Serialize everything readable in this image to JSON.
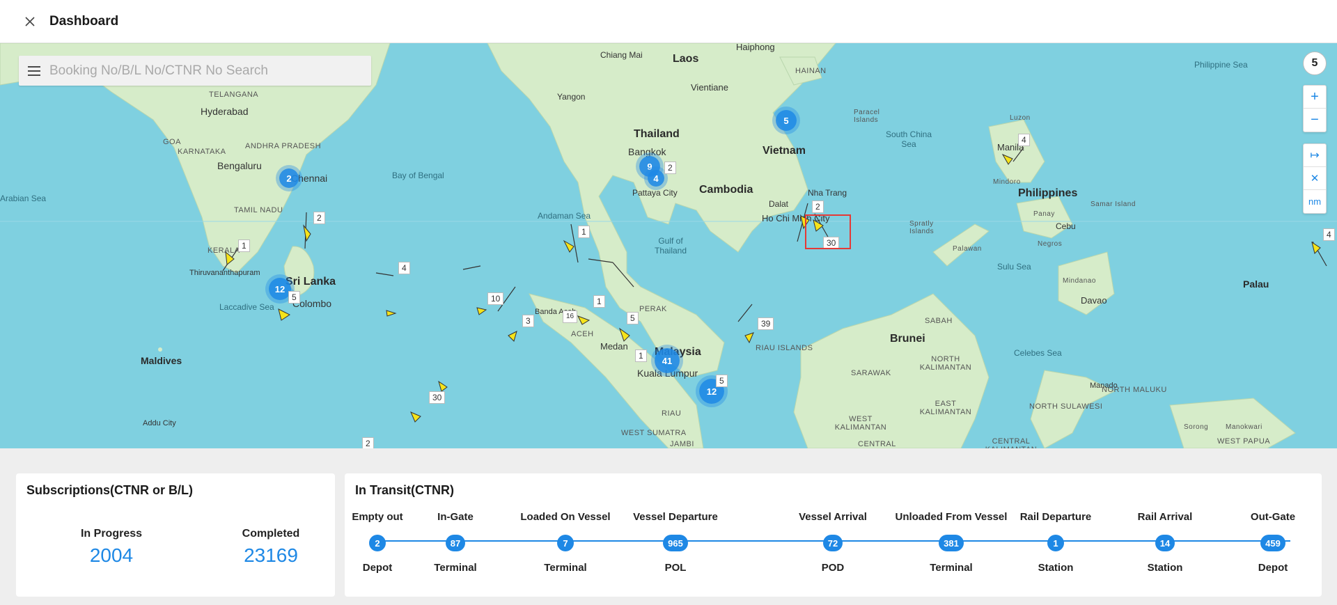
{
  "header": {
    "title": "Dashboard"
  },
  "search": {
    "placeholder": "Booking No/B/L No/CTNR No Search"
  },
  "map": {
    "zoom_level": "5",
    "controls": {
      "zoom_in": "+",
      "zoom_out": "−",
      "fit": "↦",
      "clear": "✕",
      "unit": "nm"
    },
    "countries": [
      "Laos",
      "Thailand",
      "Vietnam",
      "Cambodia",
      "Philippines",
      "Malaysia",
      "Brunei",
      "Sri Lanka",
      "Maldives",
      "Palau"
    ],
    "cities": [
      "Hyderabad",
      "Bengaluru",
      "Chennai",
      "Bangkok",
      "Pattaya City",
      "Ho Chi Minh City",
      "Nha Trang",
      "Dalat",
      "Kuala Lumpur",
      "Colombo",
      "Manila",
      "Cebu",
      "Davao",
      "Vientiane",
      "Yangon",
      "Haiphong",
      "Chiang Mai",
      "Medan",
      "Manado",
      "Addu City",
      "Thiruvananthapuram",
      "Banda Aceh"
    ],
    "seas": [
      "Bay of Bengal",
      "Andaman Sea",
      "Gulf of Thailand",
      "South China Sea",
      "Sulu Sea",
      "Celebes Sea",
      "Philippine Sea",
      "Laccadive Sea",
      "Arabian Sea"
    ],
    "regions": [
      "TELANGANA",
      "ANDHRA PRADESH",
      "KARNATAKA",
      "TAMIL NADU",
      "GOA",
      "KERALA",
      "PERAK",
      "ACEH",
      "RIAU",
      "SABAH",
      "SARAWAK",
      "NORTH KALIMANTAN",
      "EAST KALIMANTAN",
      "WEST KALIMANTAN",
      "CENTRAL KALIMANTAN",
      "NORTH SULAWESI",
      "NORTH MALUKU",
      "WEST SUMATRA",
      "JAMBI",
      "WEST PAPUA",
      "CENTRAL",
      "RIAU ISLANDS",
      "HAINAN",
      "Paracel Islands",
      "Spratly Islands",
      "Palawan",
      "Mindoro",
      "Panay",
      "Negros",
      "Mindanao",
      "Luzon",
      "Samar Island",
      "Sorong",
      "Manokwari"
    ],
    "clusters": [
      {
        "count": "5"
      },
      {
        "count": "9"
      },
      {
        "count": "4"
      },
      {
        "count": "2"
      },
      {
        "count": "12"
      },
      {
        "count": "41"
      },
      {
        "count": "12"
      }
    ],
    "vessel_tags": [
      "2",
      "4",
      "2",
      "30",
      "4",
      "1",
      "1",
      "2",
      "1",
      "4",
      "10",
      "3",
      "5",
      "1",
      "39",
      "30",
      "16",
      "5",
      "2",
      "5"
    ]
  },
  "subscriptions": {
    "title": "Subscriptions(CTNR or B/L)",
    "in_progress": {
      "label": "In Progress",
      "value": "2004"
    },
    "completed": {
      "label": "Completed",
      "value": "23169"
    }
  },
  "transit": {
    "title": "In Transit(CTNR)",
    "stages": [
      {
        "top": "Empty out",
        "count": "2",
        "bottom": "Depot"
      },
      {
        "top": "In-Gate",
        "count": "87",
        "bottom": "Terminal"
      },
      {
        "top": "Loaded On Vessel",
        "count": "7",
        "bottom": "Terminal"
      },
      {
        "top": "Vessel Departure",
        "count": "965",
        "bottom": "POL"
      },
      {
        "top": "Vessel Arrival",
        "count": "72",
        "bottom": "POD"
      },
      {
        "top": "Unloaded From Vessel",
        "count": "381",
        "bottom": "Terminal"
      },
      {
        "top": "Rail Departure",
        "count": "1",
        "bottom": "Station"
      },
      {
        "top": "Rail Arrival",
        "count": "14",
        "bottom": "Station"
      },
      {
        "top": "Out-Gate",
        "count": "459",
        "bottom": "Depot"
      }
    ]
  },
  "colors": {
    "accent": "#1e88e5",
    "water": "#7fd0e0",
    "land": "#cfe8c4",
    "vessel": "#f5e31a",
    "highlight": "#e53935"
  }
}
